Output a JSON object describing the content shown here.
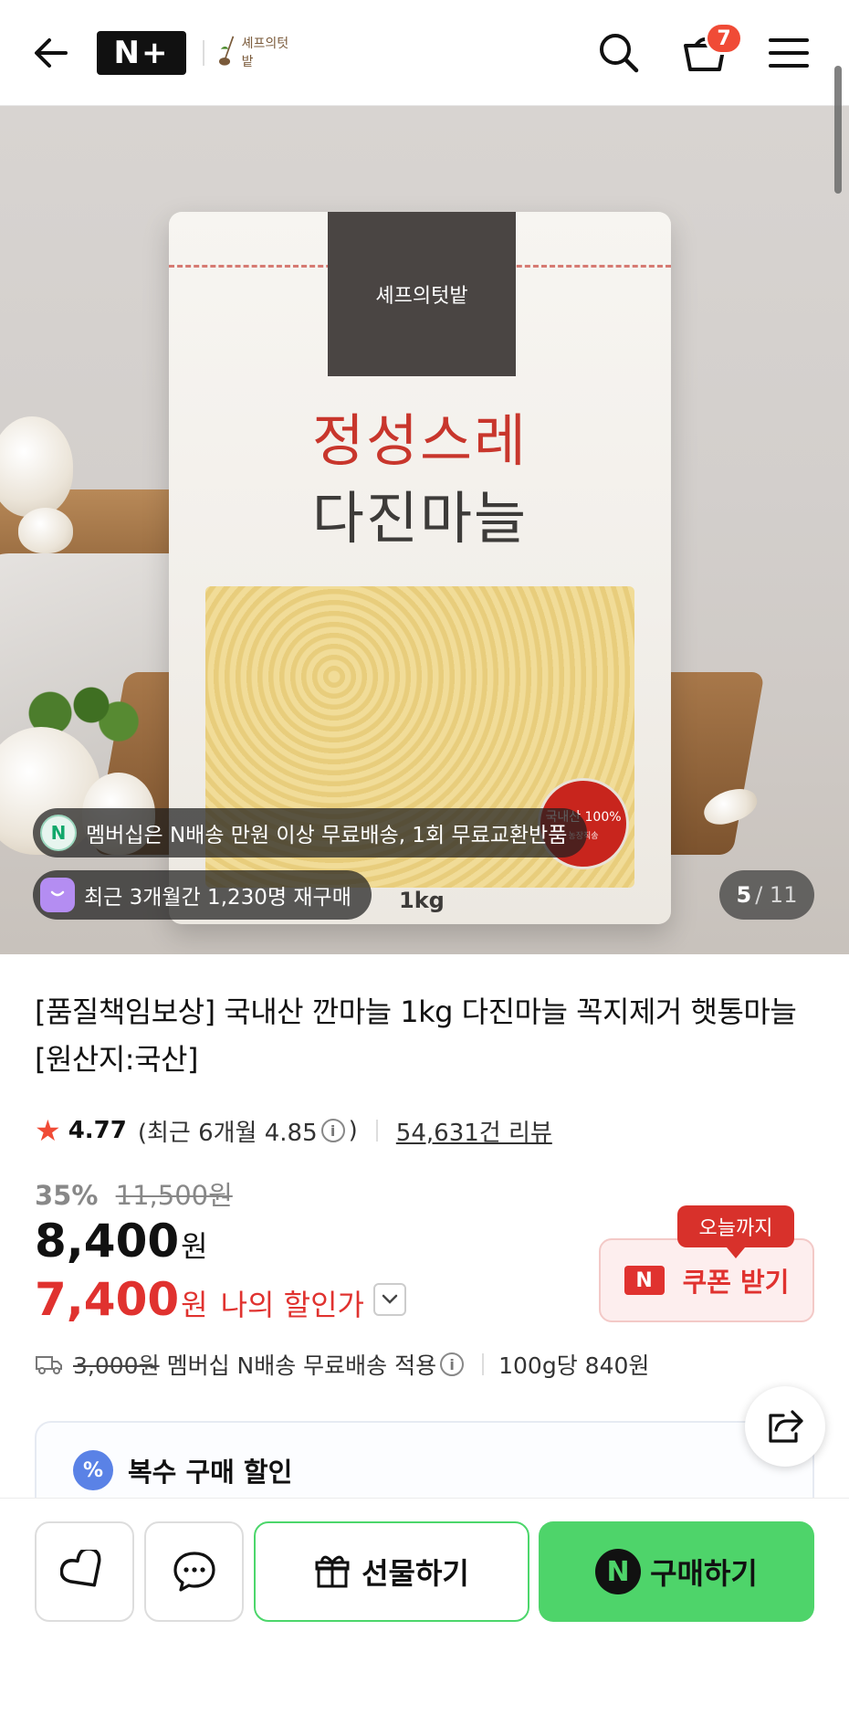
{
  "header": {
    "brand_badge": "N+",
    "store_name": "셰프의텃밭",
    "cart_count": "7",
    "icons": [
      "back-arrow-icon",
      "search-icon",
      "cart-icon",
      "hamburger-menu-icon"
    ]
  },
  "hero": {
    "bag_title_line1": "정성스레",
    "bag_title_line2": "다진마늘",
    "bag_badge_line1": "국내산 100%",
    "bag_badge_line2": "농장직송",
    "bag_weight": "1kg",
    "pill_membership": "멤버십은 N배송 만원 이상 무료배송, 1회 무료교환반품",
    "pill_repurchase": "최근 3개월간 1,230명 재구매",
    "image_index": "5",
    "image_total": "/ 11"
  },
  "product": {
    "title": "[품질책임보상] 국내산 깐마늘 1kg 다진마늘 꼭지제거 햇통마늘 [원산지:국산]",
    "rating": "4.77",
    "rating_recent": "(최근 6개월 4.85",
    "rating_recent_close": ")",
    "review_count": "54,631건 리뷰",
    "discount_pct": "35%",
    "original_price": "11,500원",
    "sale_price": "8,400",
    "won": "원",
    "my_price": "7,400",
    "my_price_label": "나의 할인가",
    "coupon_tag": "오늘까지",
    "coupon_label": "쿠폰 받기",
    "shipping_old": "3,000원",
    "shipping_text": "멤버십 N배송 무료배송 적용",
    "unit_price": "100g당 840원",
    "multi_buy": "복수 구매 할인"
  },
  "bottom_bar": {
    "gift_label": "선물하기",
    "buy_label": "구매하기"
  },
  "colors": {
    "accent_red": "#e0322f",
    "buy_green": "#4ed46a",
    "badge_red": "#f04b36"
  }
}
